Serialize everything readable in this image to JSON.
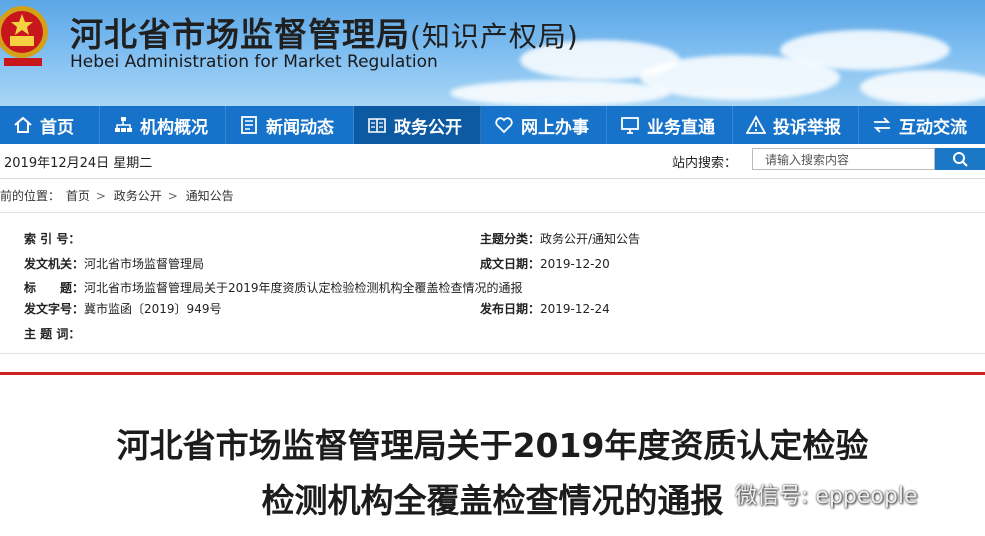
{
  "header": {
    "title_main": "河北省市场监督管理局",
    "title_paren": "(知识产权局)",
    "subtitle_en": "Hebei Administration for Market Regulation"
  },
  "nav": {
    "items": [
      {
        "label": "首页",
        "icon": "home-icon"
      },
      {
        "label": "机构概况",
        "icon": "org-chart-icon"
      },
      {
        "label": "新闻动态",
        "icon": "news-icon"
      },
      {
        "label": "政务公开",
        "icon": "document-icon",
        "active": true
      },
      {
        "label": "网上办事",
        "icon": "heart-icon"
      },
      {
        "label": "业务直通",
        "icon": "monitor-icon"
      },
      {
        "label": "投诉举报",
        "icon": "warning-icon"
      },
      {
        "label": "互动交流",
        "icon": "exchange-icon"
      }
    ]
  },
  "infobar": {
    "date": "2019年12月24日 星期二",
    "search_label": "站内搜索：",
    "search_placeholder": "请输入搜索内容"
  },
  "breadcrumb": {
    "prefix": "前的位置：",
    "items": [
      "首页",
      "政务公开",
      "通知公告"
    ],
    "separator": ">"
  },
  "meta": {
    "index_label": "索 引 号：",
    "index_value": "",
    "category_label": "主题分类：",
    "category_value": "政务公开/通知公告",
    "issuer_label": "发文机关：",
    "issuer_value": "河北省市场监督管理局",
    "created_label": "成文日期：",
    "created_value": "2019-12-20",
    "title_label": "标　　题：",
    "title_value": "河北省市场监督管理局关于2019年度资质认定检验检测机构全覆盖检查情况的通报",
    "docno_label": "发文字号：",
    "docno_value": "冀市监函〔2019〕949号",
    "published_label": "发布日期：",
    "published_value": "2019-12-24",
    "keywords_label": "主 题 词：",
    "keywords_value": ""
  },
  "article": {
    "title_line1": "河北省市场监督管理局关于2019年度资质认定检验",
    "title_line2": "检测机构全覆盖检查情况的通报"
  },
  "watermark": {
    "text": "微信号: eppeople"
  },
  "colors": {
    "nav_bg": "#1673c9",
    "nav_active": "#0d5aa3",
    "accent_red": "#cc2222"
  }
}
